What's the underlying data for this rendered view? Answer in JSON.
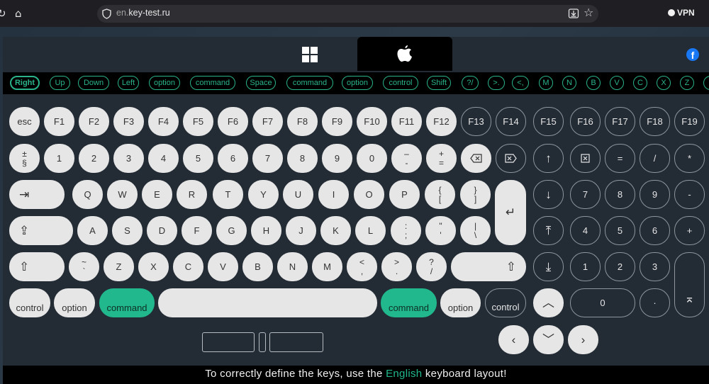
{
  "browser": {
    "url_prefix": "en.",
    "url_domain": "key-test.ru",
    "vpn_label": "VPN"
  },
  "history": [
    "Right",
    "Up",
    "Down",
    "Left",
    "option",
    "command",
    "Space",
    "command",
    "option",
    "control",
    "Shift",
    "?/",
    ">.",
    "<,",
    "M",
    "N",
    "B",
    "V",
    "C",
    "X",
    "Z",
    ""
  ],
  "keys": {
    "esc": "esc",
    "f": [
      "F1",
      "F2",
      "F3",
      "F4",
      "F5",
      "F6",
      "F7",
      "F8",
      "F9",
      "F10",
      "F11",
      "F12",
      "F13",
      "F14",
      "F15",
      "F16",
      "F17",
      "F18",
      "F19"
    ],
    "section": {
      "top": "±",
      "bottom": "§"
    },
    "digits": [
      "1",
      "2",
      "3",
      "4",
      "5",
      "6",
      "7",
      "8",
      "9",
      "0"
    ],
    "minus": {
      "top": "–",
      "bottom": "-"
    },
    "equals": {
      "top": "+",
      "bottom": "="
    },
    "row_q": [
      "Q",
      "W",
      "E",
      "R",
      "T",
      "Y",
      "U",
      "I",
      "O",
      "P"
    ],
    "bracket_open": {
      "top": "{",
      "bottom": "["
    },
    "bracket_close": {
      "top": "}",
      "bottom": "]"
    },
    "row_a": [
      "A",
      "S",
      "D",
      "F",
      "G",
      "H",
      "J",
      "K",
      "L"
    ],
    "semicolon": {
      "top": ":",
      "bottom": ";"
    },
    "quote": {
      "top": "\"",
      "bottom": "'"
    },
    "backslash": {
      "top": "|",
      "bottom": "\\"
    },
    "tilde": {
      "top": "~",
      "bottom": "`"
    },
    "row_z": [
      "Z",
      "X",
      "C",
      "V",
      "B",
      "N",
      "M"
    ],
    "comma": {
      "top": "<",
      "bottom": ","
    },
    "period": {
      "top": ">",
      "bottom": "."
    },
    "slash": {
      "top": "?",
      "bottom": "/"
    },
    "control": "control",
    "option": "option",
    "command": "command",
    "numpad_top": [
      "=",
      "/",
      "*"
    ],
    "numpad_rows": [
      [
        "7",
        "8",
        "9"
      ],
      [
        "4",
        "5",
        "6"
      ],
      [
        "1",
        "2",
        "3"
      ]
    ],
    "num_minus": "-",
    "num_plus": "+",
    "num_zero": "0",
    "num_dot": "·"
  },
  "hint": {
    "before": "To correctly define the keys, use the ",
    "accent": "English",
    "after": " keyboard layout!"
  },
  "colors": {
    "accent": "#20b88c",
    "key_fill": "#e6e6e6",
    "panel": "#232b35"
  }
}
